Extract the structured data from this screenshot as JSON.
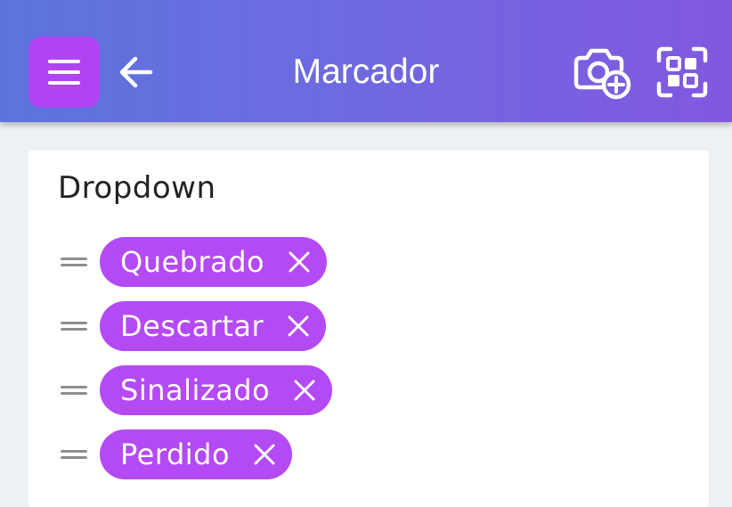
{
  "header": {
    "title": "Marcador",
    "menu_icon": "hamburger-menu-icon",
    "back_icon": "arrow-left-icon",
    "camera_icon": "camera-add-icon",
    "scan_icon": "qr-scan-icon",
    "gradient_start": "#5b74dd",
    "gradient_end": "#8258e0",
    "menu_button_color": "#b044f2"
  },
  "card": {
    "title": "Dropdown",
    "items": [
      {
        "label": "Quebrado"
      },
      {
        "label": "Descartar"
      },
      {
        "label": "Sinalizado"
      },
      {
        "label": "Perdido"
      }
    ],
    "chip_color": "#b44af4",
    "drag_icon": "drag-handle-icon",
    "remove_icon": "close-icon"
  }
}
